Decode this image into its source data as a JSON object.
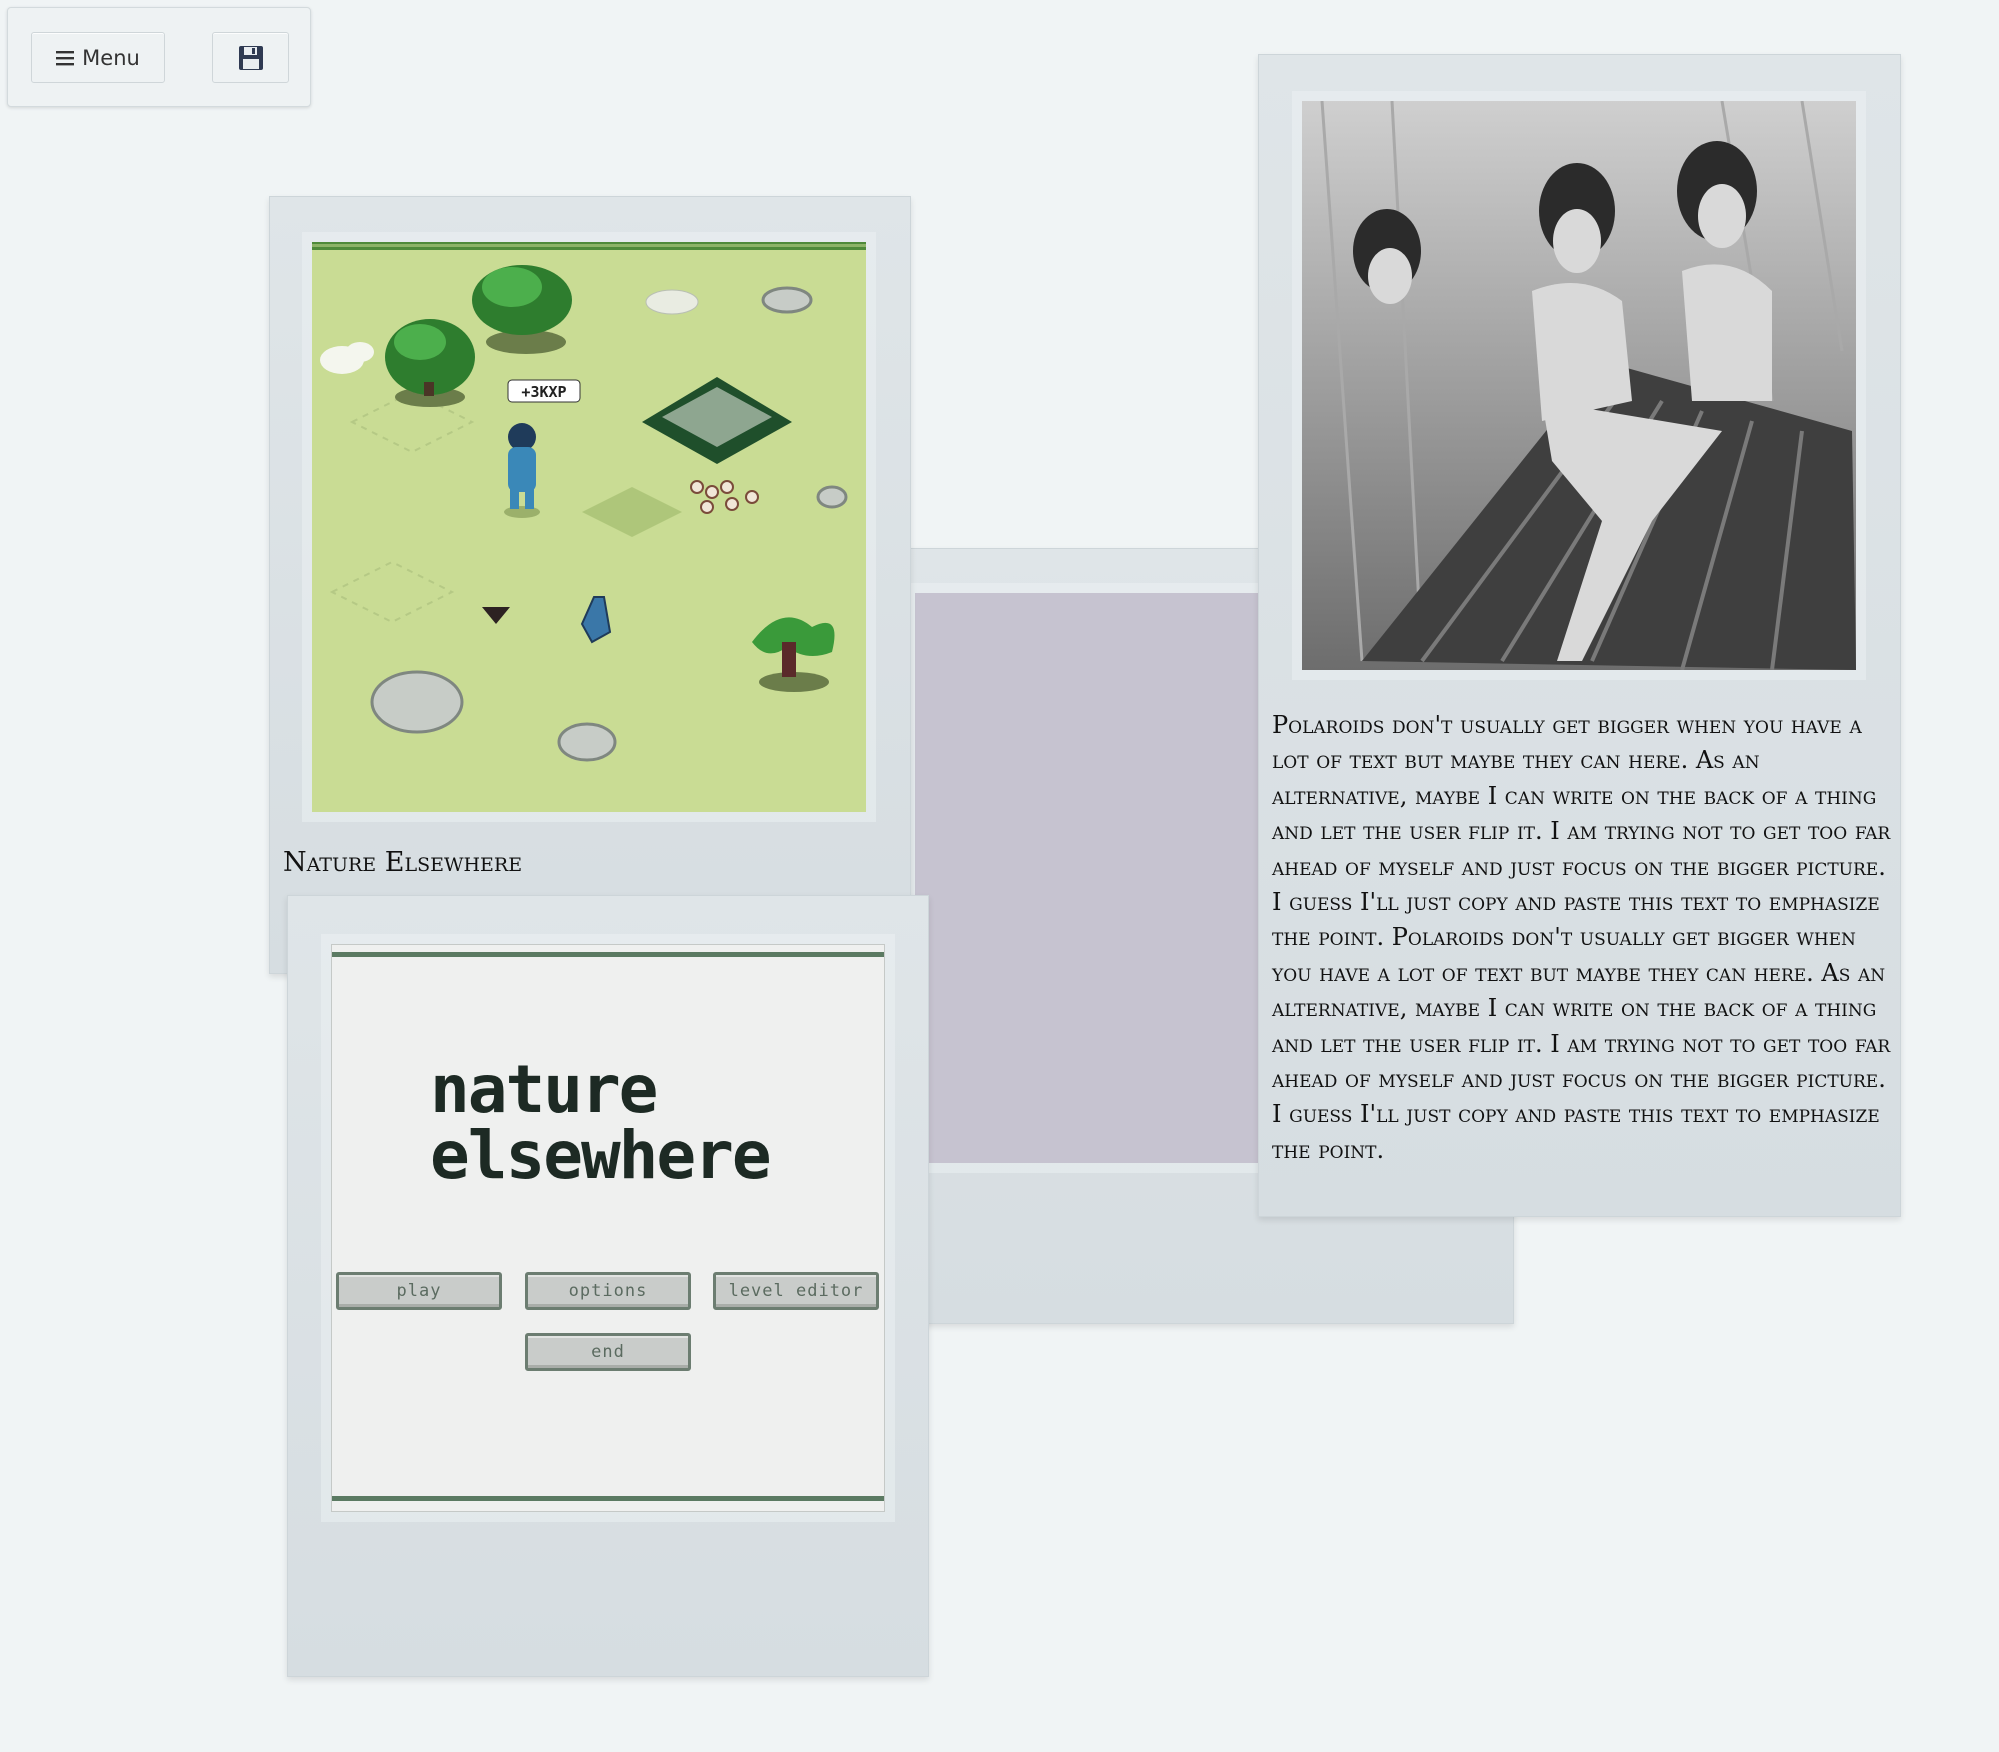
{
  "toolbar": {
    "menu_icon": "hamburger-icon",
    "menu_label": "Menu",
    "save_icon": "floppy-disk-icon"
  },
  "polaroids": {
    "nature": {
      "caption": "Nature Elsewhere",
      "xp_popup": "+3KXP"
    },
    "title_screen": {
      "title_line1": "nature",
      "title_line2": "elsewhere",
      "buttons": {
        "play": "play",
        "options": "options",
        "level_editor": "level editor",
        "end": "end"
      }
    },
    "blank": {},
    "text_card": {
      "body": "Polaroids don't usually get bigger when you have a lot of text but maybe they can here. As an alternative, maybe I can write on the back of a thing and let the user flip it. I am trying not to get too far ahead of myself and just focus on the bigger picture. I guess I'll just copy and paste this text to emphasize the point. Polaroids don't usually get bigger when you have a lot of text but maybe they can here. As an alternative, maybe I can write on the back of a thing and let the user flip it. I am trying not to get too far ahead of myself and just focus on the bigger picture. I guess I'll just copy and paste this text to emphasize the point."
    }
  },
  "colors": {
    "background": "#f0f4f5",
    "polaroid_frame": "#d9e0e3",
    "game_grass": "#c9dc94",
    "blank_photo": "#c6c3d0"
  }
}
